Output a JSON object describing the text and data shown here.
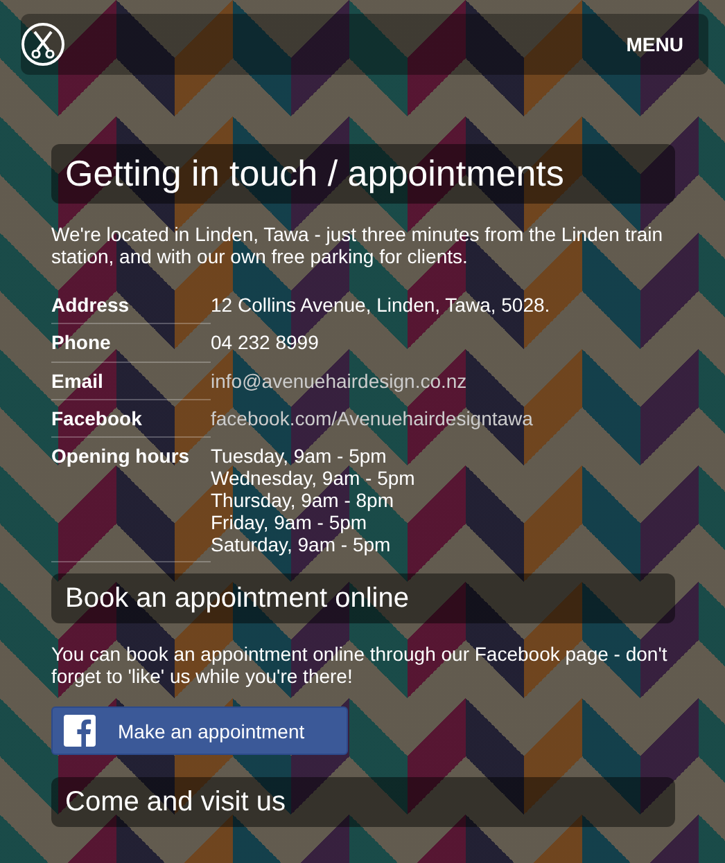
{
  "header": {
    "menu": "MENU"
  },
  "contact": {
    "heading": "Getting in touch / appointments",
    "intro": "We're located in Linden, Tawa - just three minutes from the Linden train station, and with our own free parking for clients.",
    "details": [
      {
        "label": "Address",
        "kind": "text",
        "lines": [
          "12 Collins Avenue, Linden, Tawa, 5028."
        ]
      },
      {
        "label": "Phone",
        "kind": "text",
        "lines": [
          "04 232 8999"
        ]
      },
      {
        "label": "Email",
        "kind": "link",
        "lines": [
          "info@avenuehairdesign.co.nz"
        ]
      },
      {
        "label": "Facebook",
        "kind": "link",
        "lines": [
          "facebook.com/Avenuehairdesigntawa"
        ]
      },
      {
        "label": "Opening hours",
        "kind": "text",
        "lines": [
          "Tuesday, 9am - 5pm",
          "Wednesday, 9am - 5pm",
          "Thursday, 9am - 8pm",
          "Friday, 9am - 5pm",
          "Saturday, 9am - 5pm"
        ]
      }
    ]
  },
  "booking": {
    "heading": "Book an appointment online",
    "text": "You can book an appointment online through our Facebook page - don't forget to 'like' us while you're there!",
    "button": "Make an appointment"
  },
  "visit": {
    "heading": "Come and visit us"
  }
}
